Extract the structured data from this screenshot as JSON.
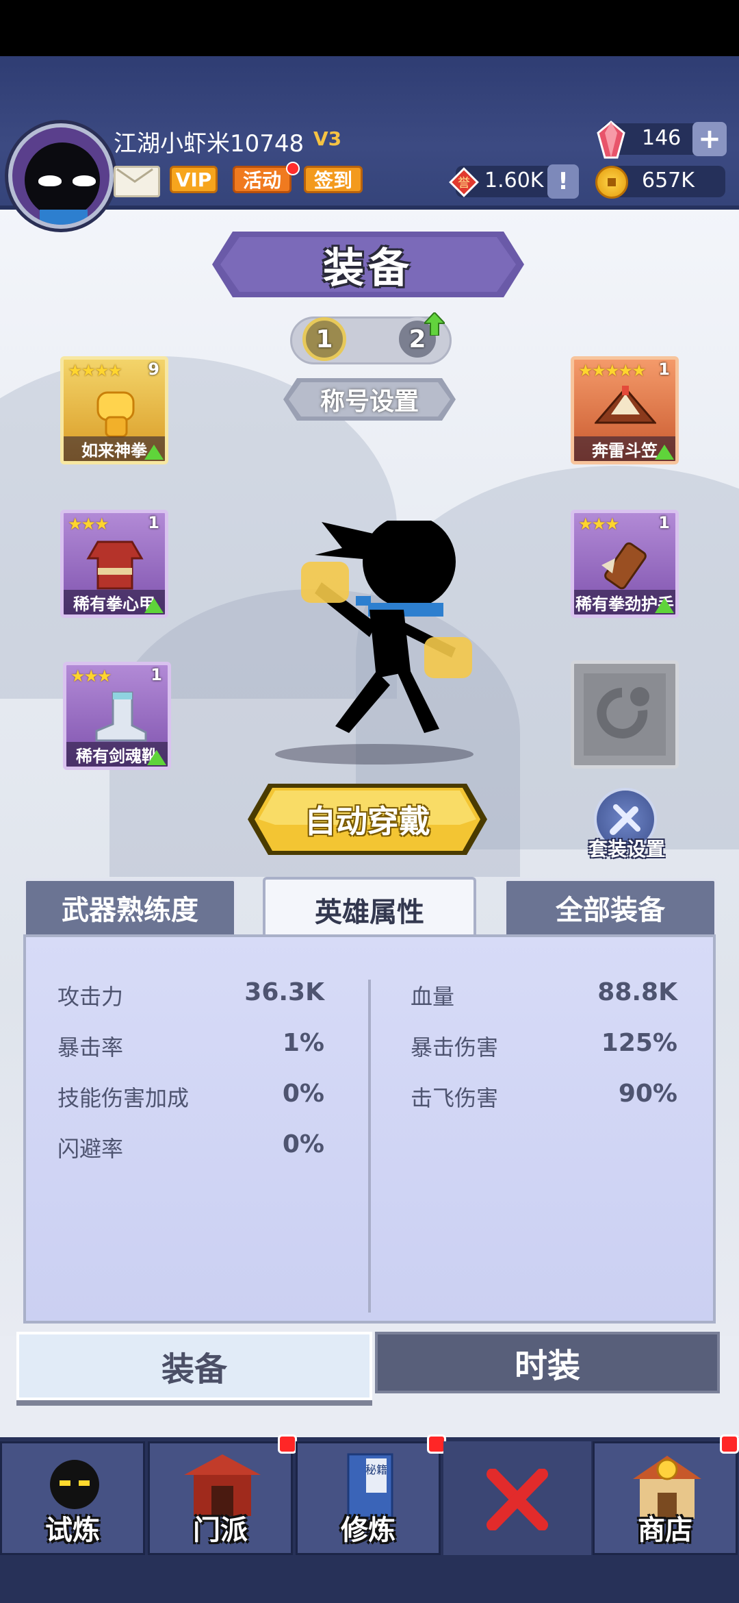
{
  "header": {
    "player_name": "江湖小虾米10748",
    "vip_level": "V3",
    "buttons": {
      "vip": "VIP",
      "activity": "活动",
      "signin": "签到"
    },
    "currency": {
      "gems": "146",
      "honor": "1.60K",
      "gold": "657K",
      "honor_icon_text": "誉"
    },
    "plus": "+",
    "info": "!"
  },
  "page": {
    "title": "装备",
    "pages": [
      "1",
      "2"
    ],
    "title_setting": "称号设置",
    "auto_equip": "自动穿戴",
    "set_setting": "套装设置"
  },
  "slots": {
    "left": [
      {
        "name": "如来神拳",
        "stars": "★★★★",
        "count": "9",
        "rarity": "gold"
      },
      {
        "name": "稀有拳心甲",
        "stars": "★★★",
        "count": "1",
        "rarity": "purple"
      },
      {
        "name": "稀有剑魂靴",
        "stars": "★★★",
        "count": "1",
        "rarity": "purple"
      }
    ],
    "right": [
      {
        "name": "奔雷斗笠",
        "stars": "★★★★★",
        "count": "1",
        "rarity": "orange"
      },
      {
        "name": "稀有拳劲护手",
        "stars": "★★★",
        "count": "1",
        "rarity": "purple"
      }
    ]
  },
  "tabs": [
    "武器熟练度",
    "英雄属性",
    "全部装备"
  ],
  "stats": {
    "left": [
      {
        "label": "攻击力",
        "value": "36.3K"
      },
      {
        "label": "暴击率",
        "value": "1%"
      },
      {
        "label": "技能伤害加成",
        "value": "0%"
      },
      {
        "label": "闪避率",
        "value": "0%"
      }
    ],
    "right": [
      {
        "label": "血量",
        "value": "88.8K"
      },
      {
        "label": "暴击伤害",
        "value": "125%"
      },
      {
        "label": "击飞伤害",
        "value": "90%"
      }
    ]
  },
  "bottom_tabs": [
    "装备",
    "时装"
  ],
  "nav": [
    {
      "label": "试炼",
      "icon": "ninja-icon"
    },
    {
      "label": "门派",
      "icon": "temple-icon"
    },
    {
      "label": "修炼",
      "icon": "book-icon",
      "book_text": "秘籍"
    },
    {
      "label": "",
      "icon": "close-icon"
    },
    {
      "label": "商店",
      "icon": "shop-icon"
    }
  ],
  "colors": {
    "accent_gold": "#f6c343",
    "panel": "#cbd0f2",
    "nav_bg": "#273158",
    "badge_red": "#ff2626"
  }
}
